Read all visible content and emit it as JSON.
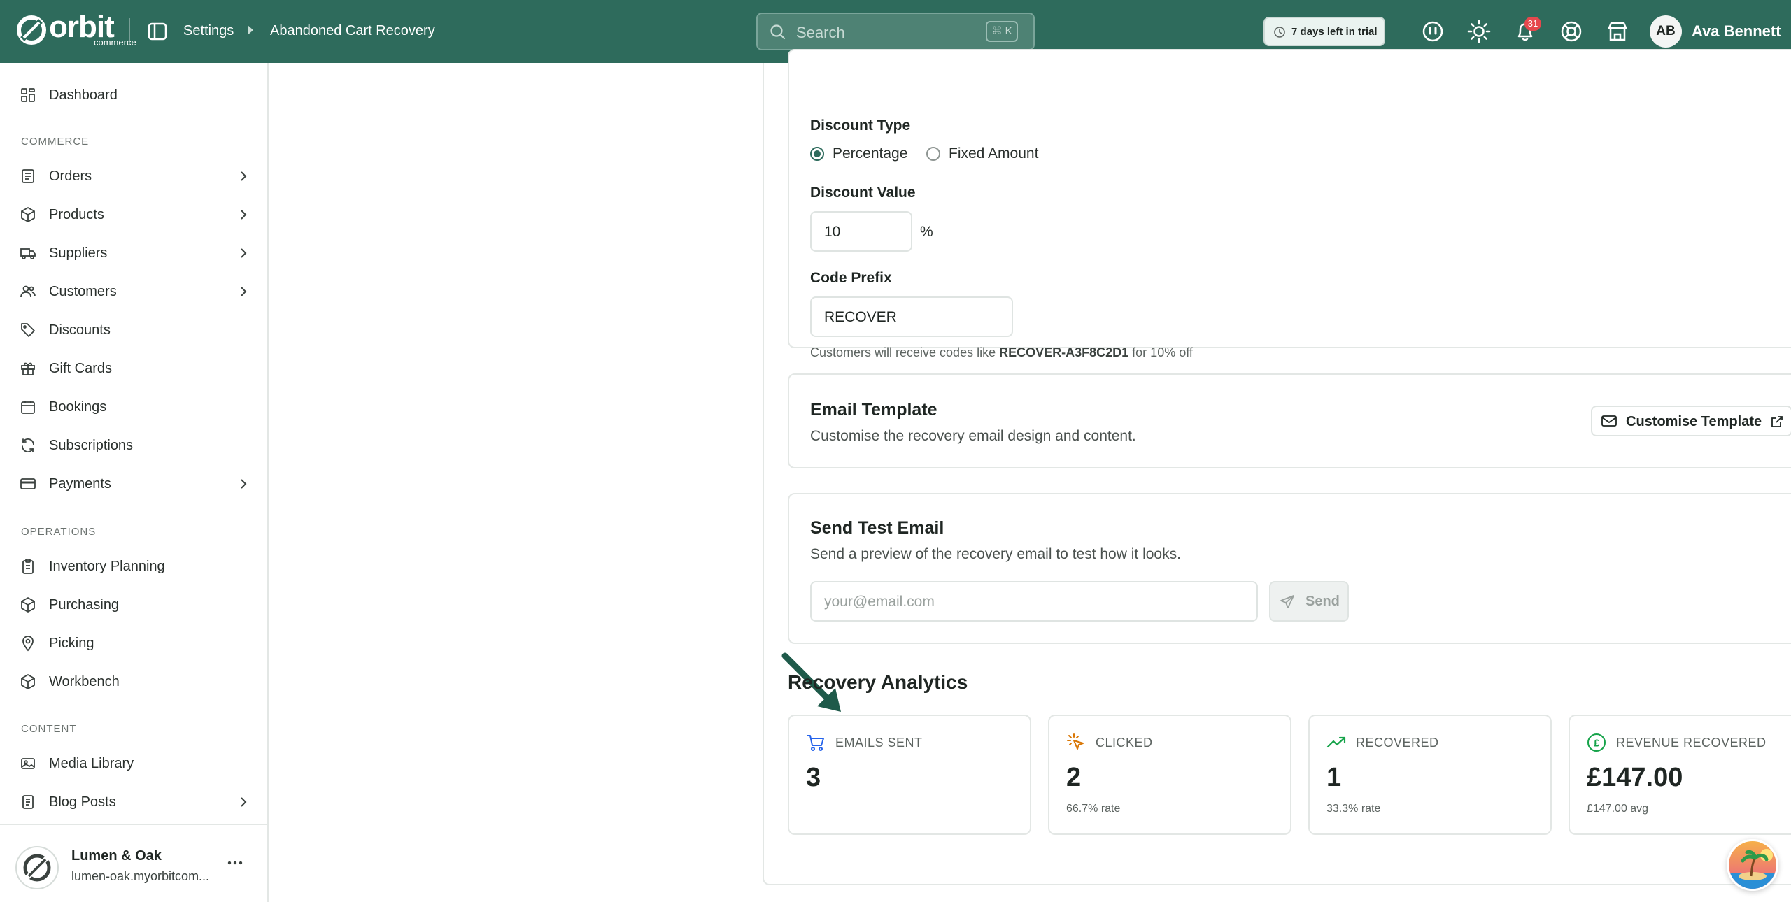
{
  "topbar": {
    "logo_word": "orbit",
    "logo_sub": "commerce",
    "breadcrumb": [
      "Settings",
      "Abandoned Cart Recovery"
    ],
    "search_placeholder": "Search",
    "search_shortcut": "⌘ K",
    "trial_text": "7 days left in trial",
    "notification_count": "31",
    "user_initials": "AB",
    "user_name": "Ava Bennett",
    "icons": [
      "sidebar-toggle-icon",
      "ai-assistant-icon",
      "sun-icon",
      "bell-icon",
      "help-icon",
      "store-icon"
    ]
  },
  "sidebar": {
    "dashboard": "Dashboard",
    "sections": {
      "commerce": "COMMERCE",
      "operations": "OPERATIONS",
      "content": "CONTENT"
    },
    "commerce_items": [
      {
        "label": "Orders",
        "icon": "orders-icon",
        "expandable": true
      },
      {
        "label": "Products",
        "icon": "box-icon",
        "expandable": true
      },
      {
        "label": "Suppliers",
        "icon": "truck-icon",
        "expandable": true
      },
      {
        "label": "Customers",
        "icon": "users-icon",
        "expandable": true
      },
      {
        "label": "Discounts",
        "icon": "tag-icon",
        "expandable": false
      },
      {
        "label": "Gift Cards",
        "icon": "gift-icon",
        "expandable": false
      },
      {
        "label": "Bookings",
        "icon": "calendar-icon",
        "expandable": false
      },
      {
        "label": "Subscriptions",
        "icon": "refresh-icon",
        "expandable": false
      },
      {
        "label": "Payments",
        "icon": "card-icon",
        "expandable": true
      }
    ],
    "operations_items": [
      {
        "label": "Inventory Planning",
        "icon": "clipboard-icon"
      },
      {
        "label": "Purchasing",
        "icon": "box-icon"
      },
      {
        "label": "Picking",
        "icon": "pin-icon"
      },
      {
        "label": "Workbench",
        "icon": "box-icon"
      }
    ],
    "content_items": [
      {
        "label": "Media Library",
        "icon": "image-icon",
        "expandable": false
      },
      {
        "label": "Blog Posts",
        "icon": "document-icon",
        "expandable": true
      }
    ],
    "store_name": "Lumen & Oak",
    "store_url": "lumen-oak.myorbitcom..."
  },
  "discount": {
    "type_label": "Discount Type",
    "option_percentage": "Percentage",
    "option_fixed": "Fixed Amount",
    "selected": "Percentage",
    "value_label": "Discount Value",
    "value": "10",
    "value_unit": "%",
    "prefix_label": "Code Prefix",
    "prefix_value": "RECOVER",
    "hint_before": "Customers will receive codes like",
    "hint_code": "RECOVER-A3F8C2D1",
    "hint_after": "for 10% off"
  },
  "email_template": {
    "title": "Email Template",
    "description": "Customise the recovery email design and content.",
    "button_label": "Customise Template"
  },
  "test_email": {
    "title": "Send Test Email",
    "description": "Send a preview of the recovery email to test how it looks.",
    "email_placeholder": "your@email.com",
    "send_label": "Send"
  },
  "analytics": {
    "title": "Recovery Analytics",
    "stats": [
      {
        "label": "EMAILS SENT",
        "value": "3",
        "sub": "",
        "icon": "cart-icon",
        "color": "#2563eb"
      },
      {
        "label": "CLICKED",
        "value": "2",
        "sub": "66.7% rate",
        "icon": "cursor-click-icon",
        "color": "#d97706"
      },
      {
        "label": "RECOVERED",
        "value": "1",
        "sub": "33.3% rate",
        "icon": "trending-up-icon",
        "color": "#16a34a"
      },
      {
        "label": "REVENUE RECOVERED",
        "value": "£147.00",
        "sub": "£147.00 avg",
        "icon": "pound-circle-icon",
        "color": "#16a34a"
      }
    ]
  },
  "colors": {
    "brand": "#2e6b5c",
    "accent_arrow": "#1f5a4a",
    "badge": "#e5484d"
  }
}
